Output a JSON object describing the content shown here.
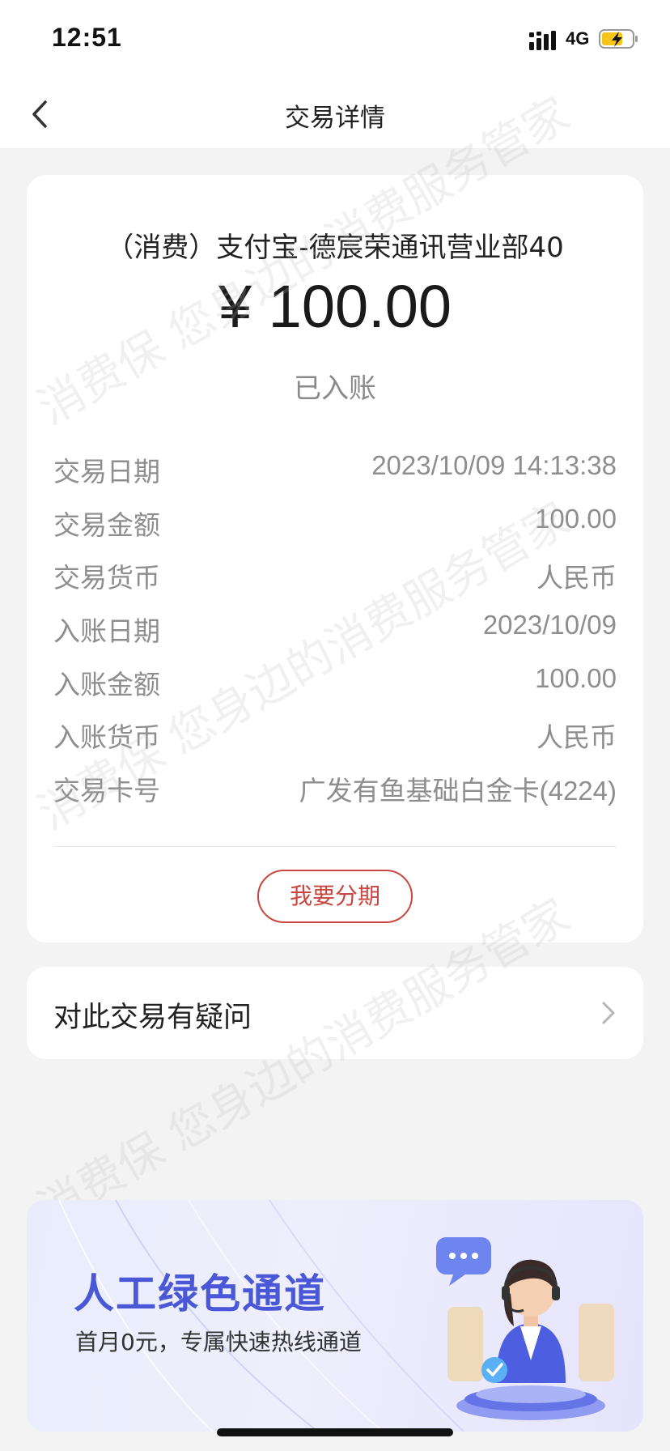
{
  "status_bar": {
    "time": "12:51",
    "network": "4G"
  },
  "nav": {
    "title": "交易详情"
  },
  "transaction": {
    "merchant": "（消费）支付宝-德宸荣通讯营业部40",
    "amount": "¥ 100.00",
    "status": "已入账",
    "rows": [
      {
        "label": "交易日期",
        "value": "2023/10/09 14:13:38"
      },
      {
        "label": "交易金额",
        "value": "100.00"
      },
      {
        "label": "交易货币",
        "value": "人民币"
      },
      {
        "label": "入账日期",
        "value": "2023/10/09"
      },
      {
        "label": "入账金额",
        "value": "100.00"
      },
      {
        "label": "入账货币",
        "value": "人民币"
      },
      {
        "label": "交易卡号",
        "value": "广发有鱼基础白金卡(4224)"
      }
    ],
    "installment_label": "我要分期"
  },
  "question": {
    "label": "对此交易有疑问"
  },
  "banner": {
    "title": "人工绿色通道",
    "subtitle": "首月0元，专属快速热线通道"
  },
  "watermark": {
    "text": "消费保 您身边的消费服务管家"
  },
  "colors": {
    "accent_red": "#c8463f",
    "banner_blue": "#4a57d6",
    "background": "#f3f3f4"
  },
  "icons": {
    "back": "chevron-left-icon",
    "row_chevron": "chevron-right-icon",
    "signal": "cellular-signal-icon",
    "battery": "battery-charging-icon",
    "agent": "customer-service-agent-icon"
  }
}
